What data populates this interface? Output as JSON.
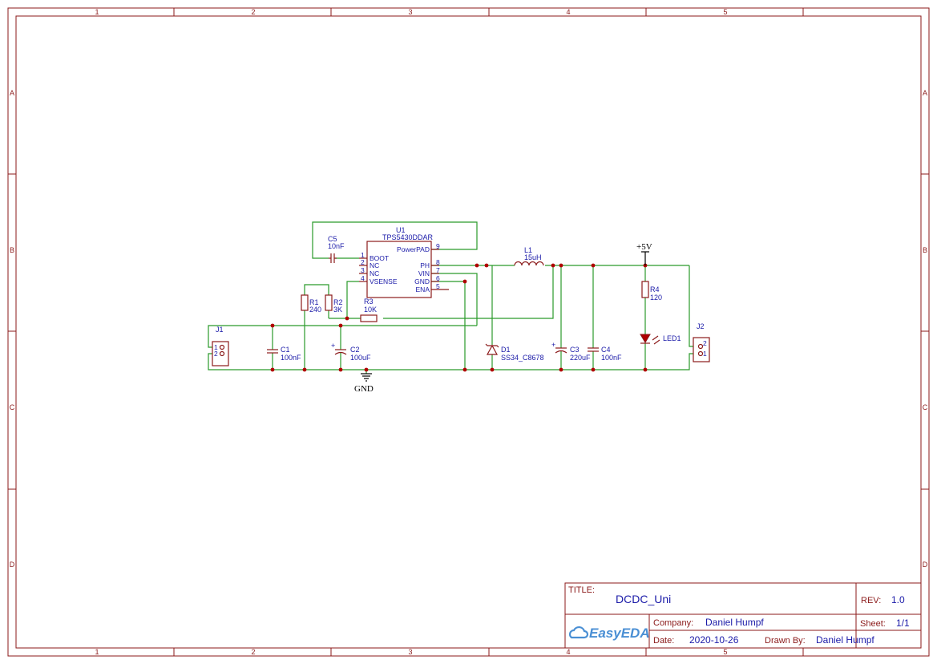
{
  "frame": {
    "columns": [
      "1",
      "2",
      "3",
      "4",
      "5"
    ],
    "rows": [
      "A",
      "B",
      "C",
      "D"
    ]
  },
  "components": {
    "u1": {
      "ref": "U1",
      "value": "TPS5430DDAR"
    },
    "c5": {
      "ref": "C5",
      "value": "10nF"
    },
    "l1": {
      "ref": "L1",
      "value": "15uH"
    },
    "r1": {
      "ref": "R1",
      "value": "240"
    },
    "r2": {
      "ref": "R2",
      "value": "3K"
    },
    "r3": {
      "ref": "R3",
      "value": "10K"
    },
    "r4": {
      "ref": "R4",
      "value": "120"
    },
    "c1": {
      "ref": "C1",
      "value": "100nF"
    },
    "c2": {
      "ref": "C2",
      "value": "100uF"
    },
    "c3": {
      "ref": "C3",
      "value": "220uF"
    },
    "c4": {
      "ref": "C4",
      "value": "100nF"
    },
    "d1": {
      "ref": "D1",
      "value": "SS34_C8678"
    },
    "led1": {
      "ref": "LED1"
    },
    "j1": {
      "ref": "J1"
    },
    "j2": {
      "ref": "J2"
    }
  },
  "u1_pins": {
    "left": [
      {
        "num": "1",
        "name": "BOOT"
      },
      {
        "num": "2",
        "name": "NC"
      },
      {
        "num": "3",
        "name": "NC"
      },
      {
        "num": "4",
        "name": "VSENSE"
      }
    ],
    "right": [
      {
        "num": "9",
        "name": "PowerPAD"
      },
      {
        "num": "8",
        "name": "PH"
      },
      {
        "num": "7",
        "name": "VIN"
      },
      {
        "num": "6",
        "name": "GND"
      },
      {
        "num": "5",
        "name": "ENA"
      }
    ]
  },
  "connector_pins": [
    "1",
    "2"
  ],
  "power": {
    "vcc": "+5V",
    "gnd": "GND"
  },
  "title_block": {
    "title_label": "TITLE:",
    "title": "DCDC_Uni",
    "rev_label": "REV:",
    "rev": "1.0",
    "company_label": "Company:",
    "company": "Daniel Humpf",
    "sheet_label": "Sheet:",
    "sheet": "1/1",
    "date_label": "Date:",
    "date": "2020-10-26",
    "drawn_label": "Drawn By:",
    "drawn_by": "Daniel Humpf",
    "logo": "EasyEDA"
  },
  "colors": {
    "frame": "#8b1a1a",
    "wire": "#2a9a2a",
    "label": "#1a1aa8",
    "junction": "#b00000"
  }
}
